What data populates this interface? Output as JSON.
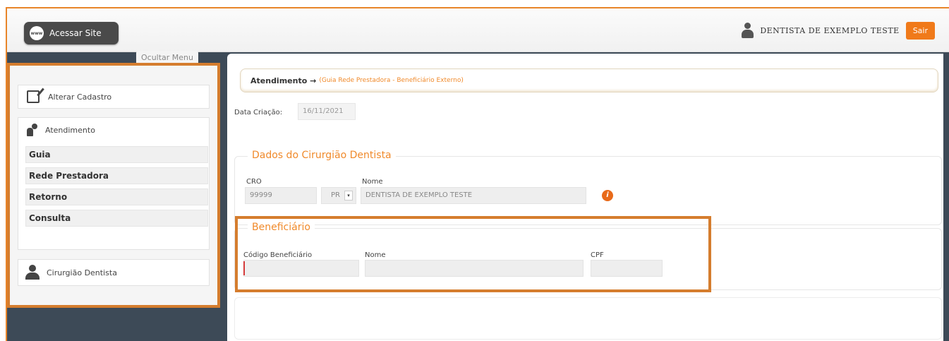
{
  "topbar": {
    "site_button_icon": "globe-www-icon",
    "site_button_icon_text": "www",
    "site_button_label": "Acessar Site",
    "user_icon": "user-icon",
    "user_name": "DENTISTA DE EXEMPLO TESTE",
    "exit_label": "Sair"
  },
  "sidebar": {
    "hide_menu_label": "Ocultar Menu",
    "alterar_cadastro": {
      "icon": "edit-icon",
      "label": "Alterar Cadastro"
    },
    "atendimento": {
      "icon": "dentist-chair-icon",
      "label": "Atendimento",
      "items": [
        {
          "label": "Guia"
        },
        {
          "label": "Rede Prestadora"
        },
        {
          "label": "Retorno"
        },
        {
          "label": "Consulta"
        }
      ]
    },
    "cirurgiao": {
      "icon": "dentist-user-icon",
      "label": "Cirurgião Dentista"
    }
  },
  "main": {
    "breadcrumb": {
      "title": "Atendimento →",
      "subtitle": "(Guia Rede Prestadora - Beneficiário Externo)"
    },
    "data_criacao": {
      "label": "Data Criação:",
      "value": "16/11/2021"
    },
    "dentista_section": {
      "legend": "Dados do Cirurgião Dentista",
      "cro_label": "CRO",
      "cro_value": "99999",
      "uf_value": "PR",
      "nome_label": "Nome",
      "nome_value": "DENTISTA DE EXEMPLO TESTE",
      "info_icon": "info-icon"
    },
    "beneficiario_section": {
      "legend": "Beneficiário",
      "codigo_label": "Código Beneficiário",
      "codigo_value": "",
      "nome_label": "Nome",
      "nome_value": "",
      "cpf_label": "CPF",
      "cpf_value": ""
    }
  },
  "colors": {
    "accent": "#f08a2b",
    "highlight_border": "#d57d2e",
    "exit_button": "#f07a1a",
    "sidebar_bg": "#3d4a57"
  }
}
